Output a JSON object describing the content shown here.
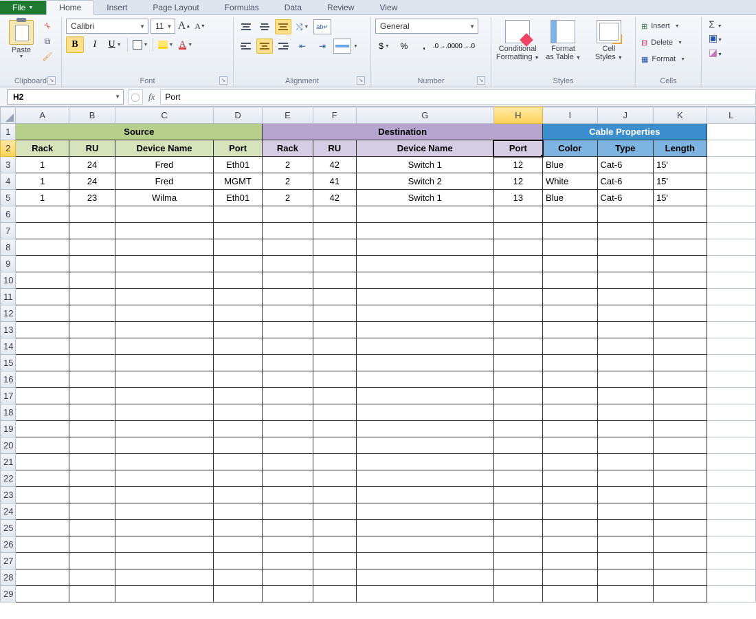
{
  "tabs": {
    "file": "File",
    "home": "Home",
    "insert": "Insert",
    "page_layout": "Page Layout",
    "formulas": "Formulas",
    "data": "Data",
    "review": "Review",
    "view": "View"
  },
  "ribbon": {
    "clipboard": {
      "label": "Clipboard",
      "paste": "Paste"
    },
    "font": {
      "label": "Font",
      "name": "Calibri",
      "size": "11",
      "bold": "B",
      "italic": "I",
      "underline": "U",
      "grow": "A",
      "shrink": "A",
      "color_letter": "A"
    },
    "alignment": {
      "label": "Alignment"
    },
    "number": {
      "label": "Number",
      "format": "General",
      "currency": "$",
      "percent": "%",
      "comma": ","
    },
    "styles": {
      "label": "Styles",
      "conditional_l1": "Conditional",
      "conditional_l2": "Formatting",
      "table_l1": "Format",
      "table_l2": "as Table",
      "cell_l1": "Cell",
      "cell_l2": "Styles"
    },
    "cells": {
      "label": "Cells",
      "insert": "Insert",
      "delete": "Delete",
      "format": "Format"
    },
    "editing": {
      "sigma": "Σ"
    }
  },
  "formula_bar": {
    "cell_ref": "H2",
    "fx": "fx",
    "value": "Port"
  },
  "columns": [
    "A",
    "B",
    "C",
    "D",
    "E",
    "F",
    "G",
    "H",
    "I",
    "J",
    "K",
    "L"
  ],
  "row_numbers": [
    1,
    2,
    3,
    4,
    5,
    6,
    7,
    8,
    9,
    10,
    11,
    12,
    13,
    14,
    15,
    16,
    17,
    18,
    19,
    20,
    21,
    22,
    23,
    24,
    25,
    26,
    27,
    28,
    29
  ],
  "headers": {
    "source": "Source",
    "destination": "Destination",
    "cable": "Cable Properties",
    "sub": {
      "rack_s": "Rack",
      "ru_s": "RU",
      "dev_s": "Device Name",
      "port_s": "Port",
      "rack_d": "Rack",
      "ru_d": "RU",
      "dev_d": "Device Name",
      "port_d": "Port",
      "color": "Color",
      "type": "Type",
      "length": "Length"
    }
  },
  "rows": [
    {
      "sr": "1",
      "sru": "24",
      "sdev": "Fred",
      "sport": "Eth01",
      "dr": "2",
      "dru": "42",
      "ddev": "Switch 1",
      "dport": "12",
      "color": "Blue",
      "type": "Cat-6",
      "len": "15'"
    },
    {
      "sr": "1",
      "sru": "24",
      "sdev": "Fred",
      "sport": "MGMT",
      "dr": "2",
      "dru": "41",
      "ddev": "Switch 2",
      "dport": "12",
      "color": "White",
      "type": "Cat-6",
      "len": "15'"
    },
    {
      "sr": "1",
      "sru": "23",
      "sdev": "Wilma",
      "sport": "Eth01",
      "dr": "2",
      "dru": "42",
      "ddev": "Switch 1",
      "dport": "13",
      "color": "Blue",
      "type": "Cat-6",
      "len": "15'"
    }
  ],
  "selected_col": "H",
  "selected_row": 2
}
